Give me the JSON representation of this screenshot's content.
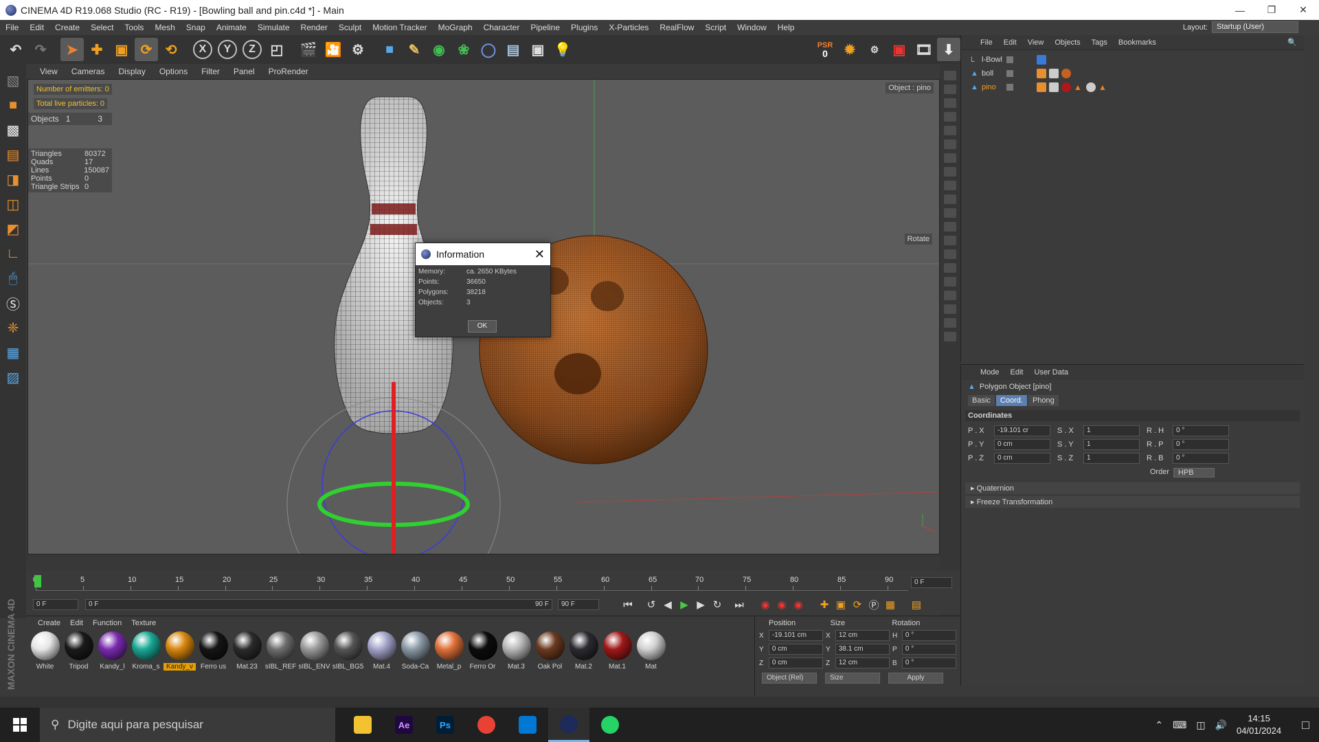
{
  "window": {
    "title": "CINEMA 4D R19.068 Studio (RC - R19) - [Bowling ball and pin.c4d *] - Main"
  },
  "menu": [
    "File",
    "Edit",
    "Create",
    "Select",
    "Tools",
    "Mesh",
    "Snap",
    "Animate",
    "Simulate",
    "Render",
    "Sculpt",
    "Motion Tracker",
    "MoGraph",
    "Character",
    "Pipeline",
    "Plugins",
    "X-Particles",
    "RealFlow",
    "Script",
    "Window",
    "Help"
  ],
  "layout": {
    "label": "Layout:",
    "value": "Startup (User)"
  },
  "toolbar": {
    "x": "X",
    "y": "Y",
    "z": "Z",
    "psr_label": "PSR",
    "psr_value": "0"
  },
  "viewport_menu": [
    "View",
    "Cameras",
    "Display",
    "Options",
    "Filter",
    "Panel",
    "ProRender"
  ],
  "viewport": {
    "emitters": "Number of emitters: 0",
    "particles": "Total live particles: 0",
    "objects_label": "Objects",
    "objects_a": "1",
    "objects_b": "3",
    "stats": [
      {
        "k": "Triangles",
        "v": "80372"
      },
      {
        "k": "Quads",
        "v": "17"
      },
      {
        "k": "Lines",
        "v": "150087"
      },
      {
        "k": "Points",
        "v": "0"
      },
      {
        "k": "Triangle Strips",
        "v": "0"
      }
    ],
    "object_hint": "Object : pino",
    "rotate_hint": "Rotate"
  },
  "dialog": {
    "title": "Information",
    "rows": [
      {
        "k": "Memory:",
        "v": "ca. 2650 KBytes"
      },
      {
        "k": "Points:",
        "v": "36650"
      },
      {
        "k": "Polygons:",
        "v": "38218"
      },
      {
        "k": "Objects:",
        "v": "3"
      }
    ],
    "ok": "OK"
  },
  "object_manager": {
    "menu": [
      "File",
      "Edit",
      "View",
      "Objects",
      "Tags",
      "Bookmarks"
    ],
    "objects": [
      {
        "name": "l-Bowl"
      },
      {
        "name": "boll"
      },
      {
        "name": "pino"
      }
    ]
  },
  "attribute_manager": {
    "menu": [
      "Mode",
      "Edit",
      "User Data"
    ],
    "title": "Polygon Object [pino]",
    "tabs": [
      "Basic",
      "Coord.",
      "Phong"
    ],
    "section": "Coordinates",
    "coords": [
      {
        "l1": "P . X",
        "v1": "-19.101 cr",
        "l2": "S . X",
        "v2": "1",
        "l3": "R . H",
        "v3": "0 °"
      },
      {
        "l1": "P . Y",
        "v1": "0 cm",
        "l2": "S . Y",
        "v2": "1",
        "l3": "R . P",
        "v3": "0 °"
      },
      {
        "l1": "P . Z",
        "v1": "0 cm",
        "l2": "S . Z",
        "v2": "1",
        "l3": "R . B",
        "v3": "0 °"
      }
    ],
    "order_label": "Order",
    "order_value": "HPB",
    "quaternion": "Quaternion",
    "freeze": "Freeze Transformation"
  },
  "timeline": {
    "ticks": [
      "0",
      "5",
      "10",
      "15",
      "20",
      "25",
      "30",
      "35",
      "40",
      "45",
      "50",
      "55",
      "60",
      "65",
      "70",
      "75",
      "80",
      "85",
      "90"
    ],
    "current_frame": "0 F",
    "start": "0 F",
    "range_start": "0 F",
    "range_end": "90 F",
    "end": "90 F"
  },
  "material_manager": {
    "menu": [
      "Create",
      "Edit",
      "Function",
      "Texture"
    ],
    "materials": [
      {
        "name": "White",
        "color": "#e6e6e6"
      },
      {
        "name": "Tripod",
        "color": "#1a1a1a"
      },
      {
        "name": "Kandy_l",
        "color": "#7a2ab0"
      },
      {
        "name": "Kroma_s",
        "color": "#1aa895"
      },
      {
        "name": "Kandy_v",
        "color": "#d8860e",
        "selected": true
      },
      {
        "name": "Ferro us",
        "color": "#151515"
      },
      {
        "name": "Mat.23",
        "color": "#2b2b2b"
      },
      {
        "name": "sIBL_REF",
        "color": "#6e6e6e"
      },
      {
        "name": "sIBL_ENV",
        "color": "#9a9a9a"
      },
      {
        "name": "sIBL_BG5",
        "color": "#555555"
      },
      {
        "name": "Mat.4",
        "color": "#a3a3c9"
      },
      {
        "name": "Soda-Ca",
        "color": "#8a9aa6"
      },
      {
        "name": "Metal_p",
        "color": "#e0703a"
      },
      {
        "name": "Ferro Or",
        "color": "#0c0c0c"
      },
      {
        "name": "Mat.3",
        "color": "#b8b8b8"
      },
      {
        "name": "Oak Pol",
        "color": "#6a3a20"
      },
      {
        "name": "Mat.2",
        "color": "#2a2a30"
      },
      {
        "name": "Mat.1",
        "color": "#a01818"
      },
      {
        "name": "Mat",
        "color": "#d0d0d0"
      }
    ]
  },
  "coordinates_manager": {
    "headers": [
      "Position",
      "Size",
      "Rotation"
    ],
    "rows": [
      {
        "a": "X",
        "p": "-19.101 cm",
        "b": "X",
        "s": "12 cm",
        "c": "H",
        "r": "0 °"
      },
      {
        "a": "Y",
        "p": "0 cm",
        "b": "Y",
        "s": "38.1 cm",
        "c": "P",
        "r": "0 °"
      },
      {
        "a": "Z",
        "p": "0 cm",
        "b": "Z",
        "s": "12 cm",
        "c": "B",
        "r": "0 °"
      }
    ],
    "mode": "Object (Rel)",
    "size_mode": "Size",
    "apply": "Apply"
  },
  "logo": "MAXON CINEMA 4D",
  "taskbar": {
    "search_placeholder": "Digite aqui para pesquisar",
    "apps": [
      {
        "name": "file-explorer",
        "label": "",
        "color": "#f2c230"
      },
      {
        "name": "after-effects",
        "label": "Ae",
        "color": "#1f0740"
      },
      {
        "name": "photoshop",
        "label": "Ps",
        "color": "#001e36"
      },
      {
        "name": "chrome",
        "label": "",
        "color": "#e94235"
      },
      {
        "name": "vscode",
        "label": "",
        "color": "#0078d4"
      },
      {
        "name": "cinema4d",
        "label": "",
        "color": "#1d2a5a"
      },
      {
        "name": "whatsapp",
        "label": "",
        "color": "#25d366"
      }
    ],
    "time": "14:15",
    "date": "04/01/2024"
  }
}
